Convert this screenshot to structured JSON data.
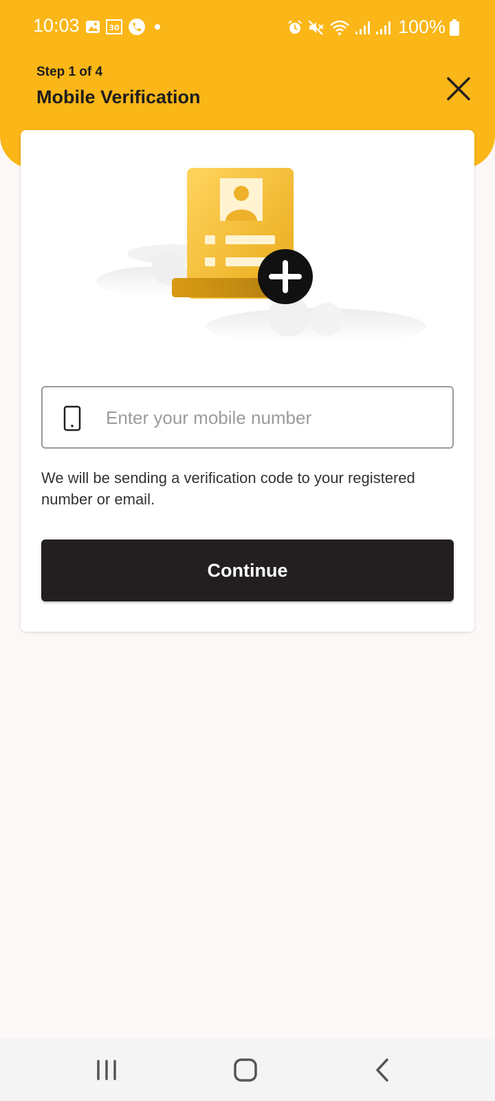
{
  "status_bar": {
    "time": "10:03",
    "battery": "100%",
    "left_icons": [
      "gallery-icon",
      "calendar-30-icon",
      "phone-call-icon",
      "notification-dot-icon"
    ],
    "right_icons": [
      "alarm-icon",
      "mute-icon",
      "wifi-icon",
      "signal-icon",
      "signal-icon",
      "battery-icon"
    ]
  },
  "header": {
    "step": "Step 1 of 4",
    "title": "Mobile Verification",
    "background_color": "#FBB617"
  },
  "form": {
    "mobile_placeholder": "Enter your mobile number",
    "mobile_value": "",
    "helper_text": "We will be sending a verification code to your registered number or email.",
    "continue_label": "Continue",
    "button_color": "#231F20"
  },
  "nav_bar": {
    "buttons": [
      "recent-apps-icon",
      "home-icon",
      "back-icon"
    ]
  }
}
